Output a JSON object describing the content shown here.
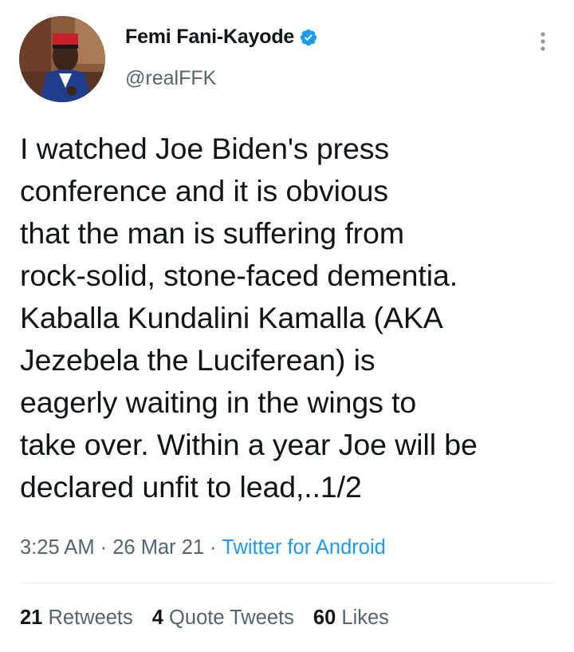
{
  "author": {
    "display_name": "Femi Fani-Kayode",
    "handle": "@realFFK",
    "verified_icon": "verified-badge-icon",
    "avatar_icon": "profile-photo"
  },
  "tweet": {
    "lines": [
      "I watched Joe Biden's press",
      "conference and it is obvious",
      "that the man is suffering from",
      "rock-solid, stone-faced dementia.",
      "Kaballa Kundalini Kamalla (AKA",
      "Jezebela the Luciferean) is",
      "eagerly waiting in the wings to",
      "take over. Within a year Joe will be",
      "declared unfit to lead,..1/2"
    ],
    "time": "3:25 AM",
    "separator": "·",
    "date": "26 Mar 21",
    "source": "Twitter for Android"
  },
  "stats": {
    "retweets_count": "21",
    "retweets_label": "Retweets",
    "quotes_count": "4",
    "quotes_label": "Quote Tweets",
    "likes_count": "60",
    "likes_label": "Likes"
  },
  "colors": {
    "text": "#0f1419",
    "secondary": "#536471",
    "accent": "#1d9bf0",
    "divider": "#e6ecf0"
  }
}
